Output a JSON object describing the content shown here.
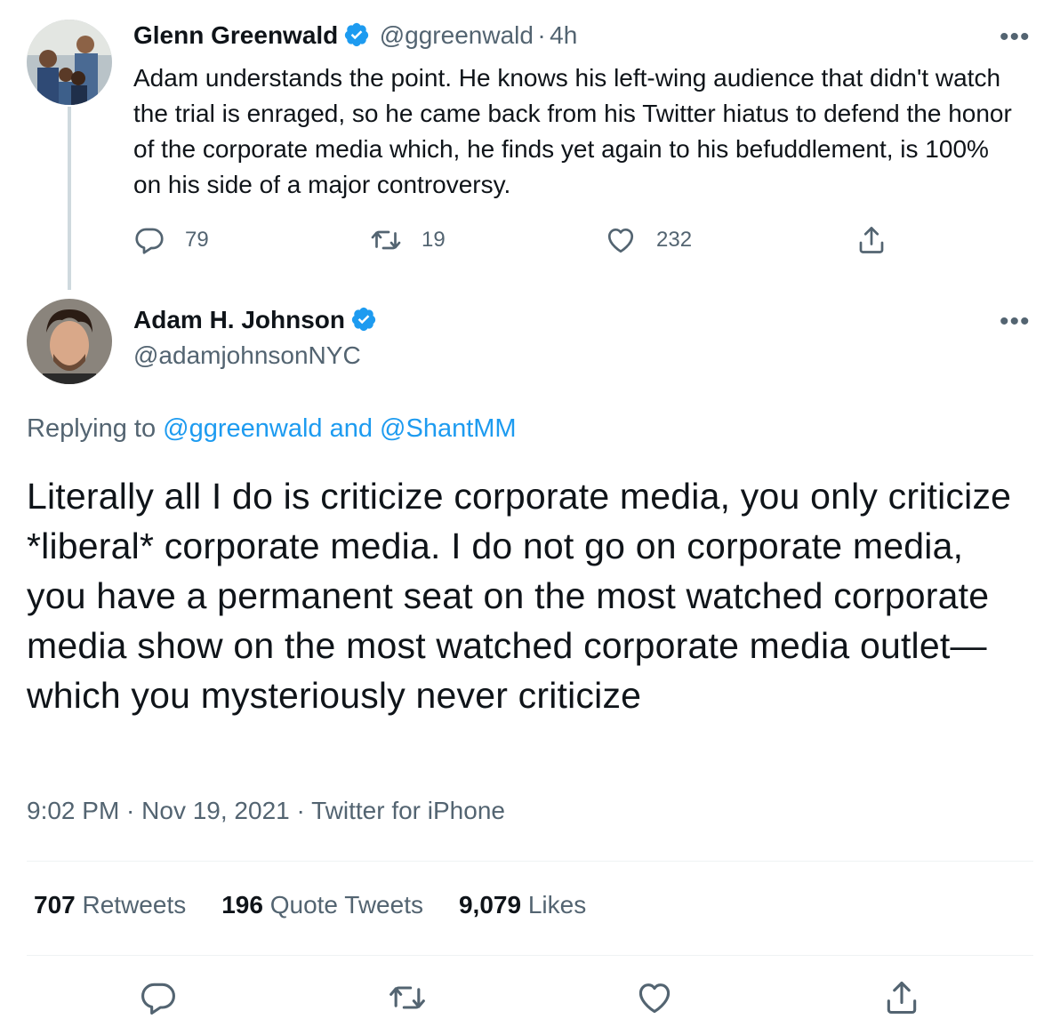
{
  "parent_tweet": {
    "author_name": "Glenn Greenwald",
    "handle": "@ggreenwald",
    "separator": "·",
    "time_ago": "4h",
    "text": "Adam understands the point. He knows his left-wing audience that didn't watch the trial is enraged, so he came back from his Twitter hiatus to defend the honor of the corporate media which, he finds yet again to his befuddlement, is 100% on his side of a major controversy.",
    "more": "•••",
    "reply_count": "79",
    "retweet_count": "19",
    "like_count": "232"
  },
  "main_tweet": {
    "author_name": "Adam H. Johnson",
    "handle": "@adamjohnsonNYC",
    "more": "•••",
    "replying_prefix": "Replying to",
    "replying_users": "@ggreenwald and @ShantMM",
    "text": "Literally all I do is criticize corporate media, you only criticize *liberal* corporate media. I do not go on corporate media, you have a permanent seat on the most watched corporate media show on the most watched corporate media outlet—which you mysteriously never criticize",
    "meta": "9:02 PM · Nov 19, 2021 · Twitter for iPhone",
    "retweets_value": "707",
    "retweets_label": "Retweets",
    "quotes_value": "196",
    "quotes_label": "Quote Tweets",
    "likes_value": "9,079",
    "likes_label": "Likes"
  },
  "icons": {
    "reply": "reply-icon",
    "retweet": "retweet-icon",
    "like": "heart-icon",
    "share": "share-icon",
    "verified": "verified-badge-icon"
  },
  "colors": {
    "text": "#0f1419",
    "secondary": "#536471",
    "link": "#1d9bf0",
    "divider": "#eff3f4"
  }
}
